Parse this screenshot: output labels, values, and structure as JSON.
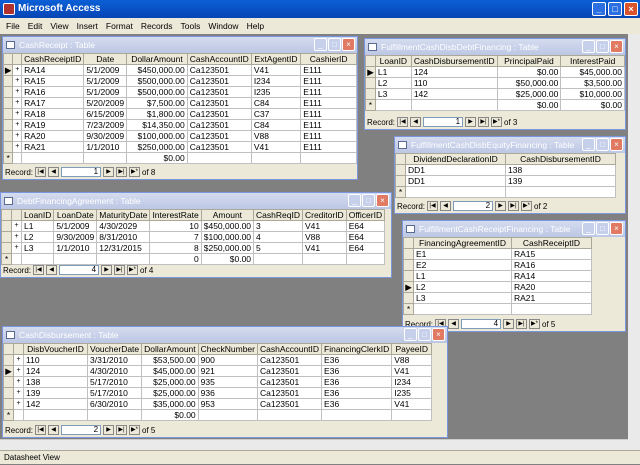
{
  "app": {
    "title": "Microsoft Access",
    "menu": [
      "File",
      "Edit",
      "View",
      "Insert",
      "Format",
      "Records",
      "Tools",
      "Window",
      "Help"
    ],
    "status": "Datasheet View"
  },
  "cashreceipt": {
    "title": "CashReceipt : Table",
    "columns": [
      "CashReceiptID",
      "Date",
      "DollarAmount",
      "CashAccountID",
      "ExtAgentID",
      "CashierID"
    ],
    "rows": [
      [
        "RA14",
        "5/1/2009",
        "$450,000.00",
        "Ca123501",
        "V41",
        "E111"
      ],
      [
        "RA15",
        "5/1/2009",
        "$500,000.00",
        "Ca123501",
        "I234",
        "E111"
      ],
      [
        "RA16",
        "5/1/2009",
        "$500,000.00",
        "Ca123501",
        "I235",
        "E111"
      ],
      [
        "RA17",
        "5/20/2009",
        "$7,500.00",
        "Ca123501",
        "C84",
        "E111"
      ],
      [
        "RA18",
        "6/15/2009",
        "$1,800.00",
        "Ca123501",
        "C37",
        "E111"
      ],
      [
        "RA19",
        "7/23/2009",
        "$14,350.00",
        "Ca123501",
        "C84",
        "E111"
      ],
      [
        "RA20",
        "9/30/2009",
        "$100,000.00",
        "Ca123501",
        "V88",
        "E111"
      ],
      [
        "RA21",
        "1/1/2010",
        "$250,000.00",
        "Ca123501",
        "V41",
        "E111"
      ]
    ],
    "newrow": [
      "",
      "",
      "$0.00",
      "",
      "",
      ""
    ],
    "record": "1",
    "of": "of 8"
  },
  "fulfilldebt": {
    "title": "FulfillmentCashDisbDebtFinancing : Table",
    "columns": [
      "LoanID",
      "CashDisbursementID",
      "PrincipalPaid",
      "InterestPaid"
    ],
    "rows": [
      [
        "L1",
        "124",
        "$0.00",
        "$45,000.00"
      ],
      [
        "L2",
        "110",
        "$50,000.00",
        "$3,500.00"
      ],
      [
        "L3",
        "142",
        "$25,000.00",
        "$10,000.00"
      ]
    ],
    "newrow": [
      "",
      "",
      "$0.00",
      "$0.00"
    ],
    "record": "1",
    "of": "of 3"
  },
  "fulfillequity": {
    "title": "FulfillmentCashDisbEquityFinancing : Table",
    "columns": [
      "DividendDeclarationID",
      "CashDisbursementID"
    ],
    "rows": [
      [
        "DD1",
        "138"
      ],
      [
        "DD1",
        "139"
      ]
    ],
    "record": "2",
    "of": "of 2"
  },
  "debtfin": {
    "title": "DebtFinancingAgreement : Table",
    "columns": [
      "LoanID",
      "LoanDate",
      "MaturityDate",
      "InterestRate",
      "Amount",
      "CashReqID",
      "CreditorID",
      "OfficerID"
    ],
    "rows": [
      [
        "L1",
        "5/1/2009",
        "4/30/2029",
        "10",
        "$450,000.00",
        "3",
        "V41",
        "E64"
      ],
      [
        "L2",
        "9/30/2009",
        "8/31/2010",
        "7",
        "$100,000.00",
        "4",
        "V88",
        "E64"
      ],
      [
        "L3",
        "1/1/2010",
        "12/31/2015",
        "8",
        "$250,000.00",
        "5",
        "V41",
        "E64"
      ]
    ],
    "newrow": [
      "",
      "",
      "",
      "0",
      "$0.00",
      "",
      "",
      ""
    ],
    "record": "4",
    "of": "of 4"
  },
  "fulfillreceipt": {
    "title": "FulfillmentCashReceiptFinancing : Table",
    "columns": [
      "FinancingAgreementID",
      "CashReceiptID"
    ],
    "rows": [
      [
        "E1",
        "RA15"
      ],
      [
        "E2",
        "RA16"
      ],
      [
        "L1",
        "RA14"
      ],
      [
        "L2",
        "RA20"
      ],
      [
        "L3",
        "RA21"
      ]
    ],
    "record": "4",
    "of": "of 5"
  },
  "cashdisb": {
    "title": "CashDisbursement : Table",
    "columns": [
      "DisbVoucherID",
      "VoucherDate",
      "DollarAmount",
      "CheckNumber",
      "CashAccountID",
      "FinancingClerkID",
      "PayeeID"
    ],
    "rows": [
      [
        "110",
        "3/31/2010",
        "$53,500.00",
        "900",
        "Ca123501",
        "E36",
        "V88"
      ],
      [
        "124",
        "4/30/2010",
        "$45,000.00",
        "921",
        "Ca123501",
        "E36",
        "V41"
      ],
      [
        "138",
        "5/17/2010",
        "$25,000.00",
        "935",
        "Ca123501",
        "E36",
        "I234"
      ],
      [
        "139",
        "5/17/2010",
        "$25,000.00",
        "936",
        "Ca123501",
        "E36",
        "I235"
      ],
      [
        "142",
        "6/30/2010",
        "$35,000.00",
        "953",
        "Ca123501",
        "E36",
        "V41"
      ]
    ],
    "newrow": [
      "",
      "",
      "$0.00",
      "",
      "",
      "",
      ""
    ],
    "record": "2",
    "of": "of 5"
  },
  "nav": {
    "label": "Record:"
  }
}
